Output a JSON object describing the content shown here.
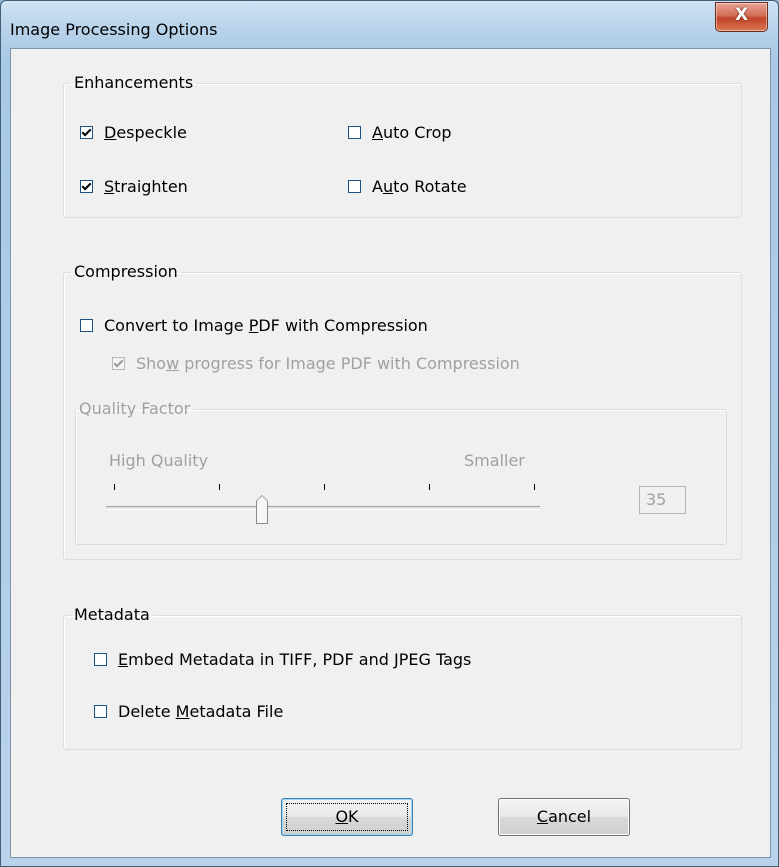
{
  "window": {
    "title": "Image Processing Options",
    "close_glyph": "X"
  },
  "enhancements": {
    "legend": "Enhancements",
    "items": [
      {
        "label_u": "D",
        "label_rest": "especkle",
        "checked": true
      },
      {
        "label_u": "S",
        "label_rest": "traighten",
        "checked": true
      },
      {
        "label_u": "A",
        "label_rest": "uto Crop",
        "checked": false
      },
      {
        "label_pre": "A",
        "label_u": "u",
        "label_rest": "to Rotate",
        "checked": false
      }
    ]
  },
  "compression": {
    "legend": "Compression",
    "convert": {
      "label_pre": "Convert to Image ",
      "label_u": "P",
      "label_rest": "DF with Compression",
      "checked": false
    },
    "progress": {
      "label_pre": "Sho",
      "label_u": "w",
      "label_rest": " progress for Image PDF with Compression",
      "checked": true,
      "disabled": true
    },
    "quality": {
      "legend": "Quality Factor",
      "low_label": "High Quality",
      "high_label": "Smaller",
      "value": "35",
      "slider_fraction": 0.35
    }
  },
  "metadata": {
    "legend": "Metadata",
    "embed": {
      "label_u": "E",
      "label_rest": "mbed Metadata in TIFF, PDF and JPEG Tags",
      "checked": false
    },
    "delete": {
      "label_pre": "Delete ",
      "label_u": "M",
      "label_rest": "etadata File",
      "checked": false
    }
  },
  "buttons": {
    "ok_u": "O",
    "ok_rest": "K",
    "cancel_u": "C",
    "cancel_rest": "ancel"
  }
}
